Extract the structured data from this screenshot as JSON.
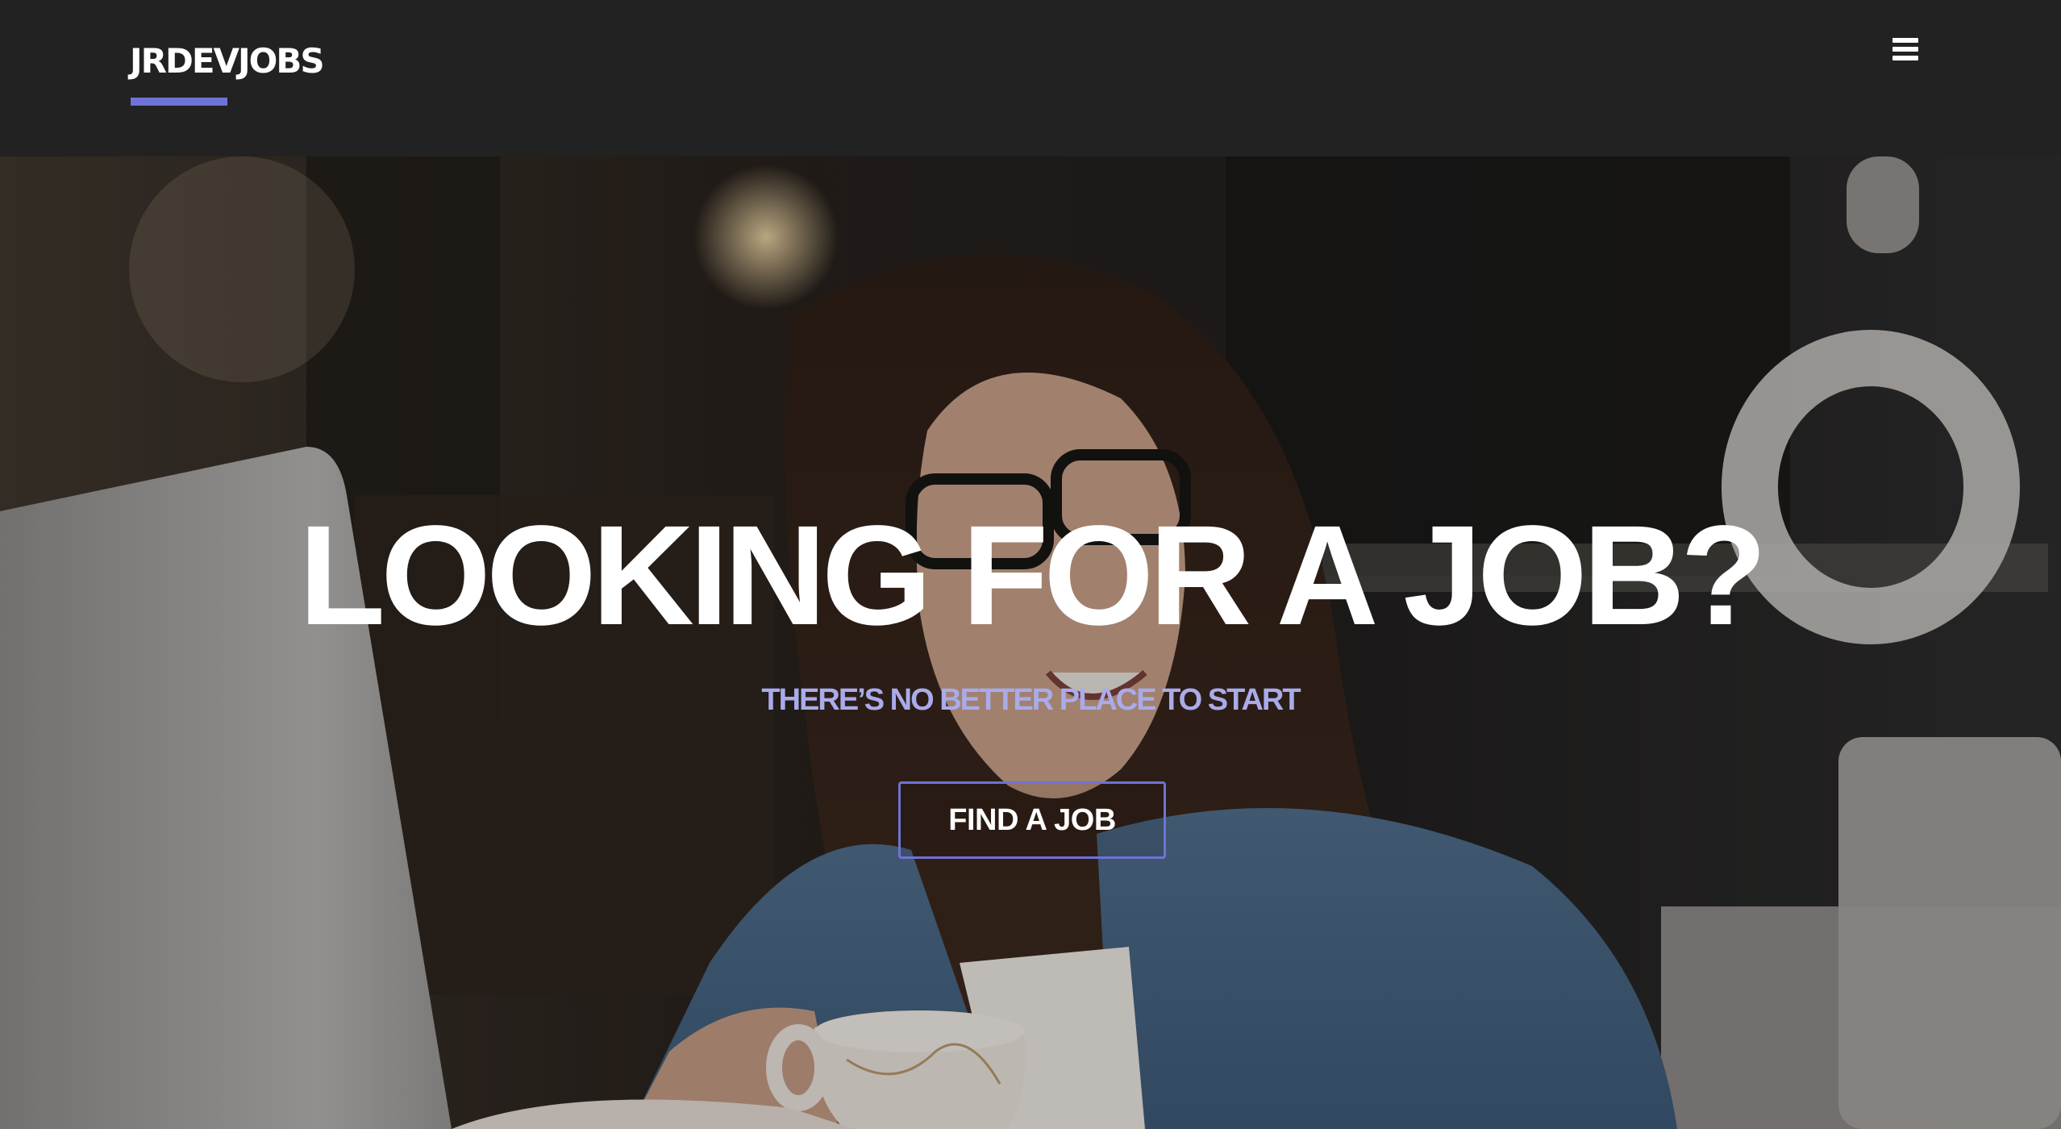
{
  "navbar": {
    "brand": "JRDEVJOBS",
    "menu_icon": "hamburger-menu-icon"
  },
  "hero": {
    "title": "LOOKING FOR A JOB?",
    "subtitle": "THERE’S NO BETTER PLACE TO START",
    "cta_label": "FIND A JOB"
  },
  "colors": {
    "navbar_bg": "#222222",
    "accent": "#6f72d6",
    "subtitle": "#a9abea",
    "text": "#ffffff"
  }
}
